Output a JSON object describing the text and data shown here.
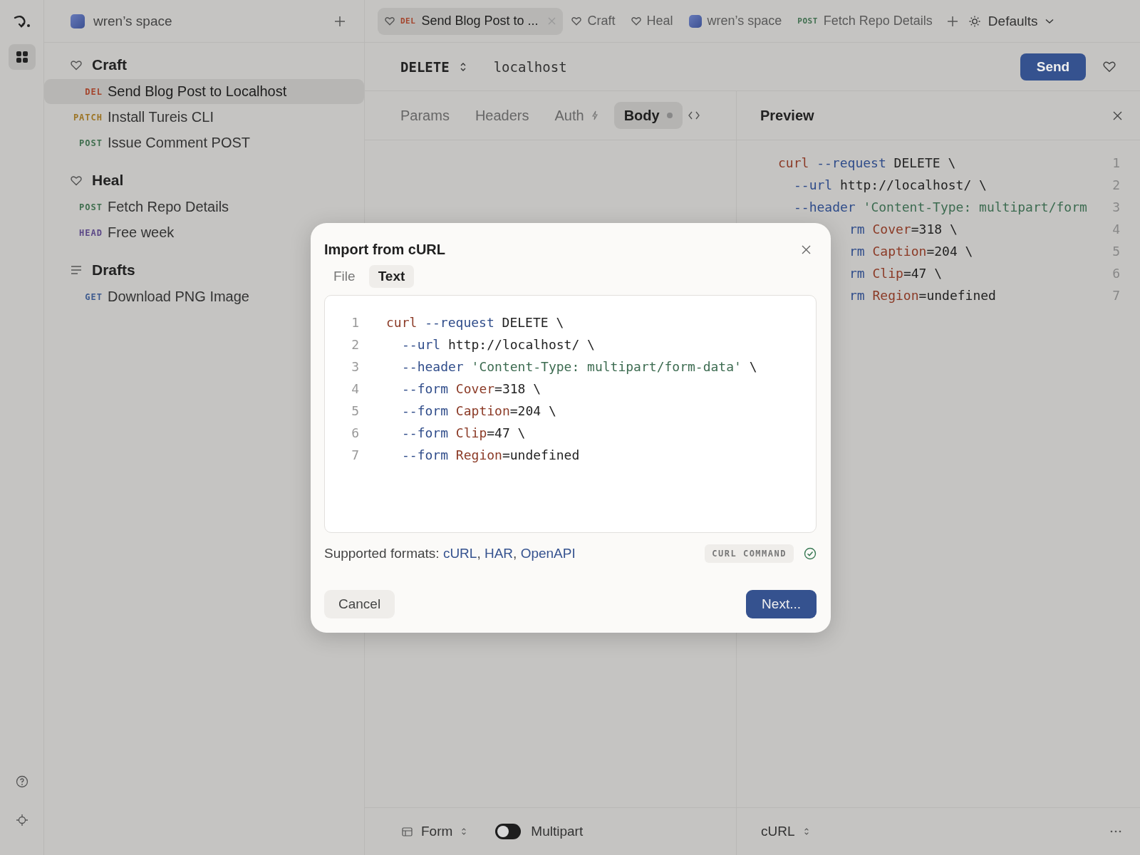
{
  "rail": {
    "items": [
      {
        "kind": "apps",
        "selected": true
      }
    ]
  },
  "sidebar": {
    "workspace": "wren’s space",
    "groups": [
      {
        "kind": "folder",
        "title": "Craft",
        "items": [
          {
            "method": "DEL",
            "label": "Send Blog Post to Localhost",
            "selected": true
          },
          {
            "method": "PATCH",
            "label": "Install Tureis CLI",
            "selected": false
          },
          {
            "method": "POST",
            "label": "Issue Comment POST",
            "selected": false
          }
        ]
      },
      {
        "kind": "folder",
        "title": "Heal",
        "items": [
          {
            "method": "POST",
            "label": "Fetch Repo Details",
            "selected": false
          },
          {
            "method": "HEAD",
            "label": "Free week",
            "selected": false
          }
        ]
      },
      {
        "kind": "drafts",
        "title": "Drafts",
        "items": [
          {
            "method": "GET",
            "label": "Download PNG Image",
            "selected": false
          }
        ]
      }
    ]
  },
  "tabs": [
    {
      "kind": "folder",
      "method": "DEL",
      "label": "Send Blog Post to ...",
      "selected": true,
      "closable": true
    },
    {
      "kind": "folder",
      "label": "Craft",
      "selected": false,
      "closable": false
    },
    {
      "kind": "folder",
      "label": "Heal",
      "selected": false,
      "closable": false
    },
    {
      "kind": "workspace",
      "label": "wren’s space",
      "selected": false,
      "closable": false
    },
    {
      "kind": "request",
      "method": "POST",
      "label": "Fetch Repo Details",
      "selected": false,
      "closable": false
    }
  ],
  "environment": "Defaults",
  "request": {
    "method": "DELETE",
    "url": "localhost",
    "send": "Send"
  },
  "body_tabs": [
    {
      "kind": "plain",
      "label": "Params",
      "selected": false
    },
    {
      "kind": "plain",
      "label": "Headers",
      "selected": false
    },
    {
      "kind": "bolt",
      "label": "Auth",
      "selected": false
    },
    {
      "kind": "dot",
      "label": "Body",
      "selected": true
    }
  ],
  "preview": {
    "title": "Preview",
    "lines": [
      {
        "number": "1",
        "kind": "first",
        "tokens": [
          {
            "kind": "cmd",
            "text": "curl"
          },
          {
            "kind": "flag",
            "text": " --request"
          },
          {
            "kind": "plain",
            "text": " DELETE \\"
          }
        ]
      },
      {
        "number": "2",
        "kind": "cont",
        "tokens": [
          {
            "kind": "flag",
            "text": "--url"
          },
          {
            "kind": "plain",
            "text": " http://localhost/ \\"
          }
        ]
      },
      {
        "number": "3",
        "kind": "cont",
        "tokens": [
          {
            "kind": "flag",
            "text": "--header"
          },
          {
            "kind": "str",
            "text": " 'Content-Type: multipart/form"
          }
        ]
      },
      {
        "number": "4",
        "kind": "cut",
        "tokens": [
          {
            "kind": "flag",
            "text": "rm"
          },
          {
            "kind": "key",
            "text": " Cover"
          },
          {
            "kind": "plain",
            "text": "=318 \\"
          }
        ]
      },
      {
        "number": "5",
        "kind": "cut",
        "tokens": [
          {
            "kind": "flag",
            "text": "rm"
          },
          {
            "kind": "key",
            "text": " Caption"
          },
          {
            "kind": "plain",
            "text": "=204 \\"
          }
        ]
      },
      {
        "number": "6",
        "kind": "cut",
        "tokens": [
          {
            "kind": "flag",
            "text": "rm"
          },
          {
            "kind": "key",
            "text": " Clip"
          },
          {
            "kind": "plain",
            "text": "=47 \\"
          }
        ]
      },
      {
        "number": "7",
        "kind": "cut",
        "tokens": [
          {
            "kind": "flag",
            "text": "rm"
          },
          {
            "kind": "key",
            "text": " Region"
          },
          {
            "kind": "plain",
            "text": "=undefined"
          }
        ]
      }
    ]
  },
  "footer": {
    "body_type": "Form",
    "multipart": {
      "label": "Multipart",
      "on": false
    },
    "preview_format": "cURL"
  },
  "dialog": {
    "title": "Import from cURL",
    "tabs": [
      {
        "label": "File",
        "selected": false
      },
      {
        "label": "Text",
        "selected": true
      }
    ],
    "lines": [
      {
        "number": "1",
        "kind": "first",
        "tokens": [
          {
            "kind": "cmd",
            "text": "curl"
          },
          {
            "kind": "flag",
            "text": " --request"
          },
          {
            "kind": "plain",
            "text": " DELETE \\"
          }
        ]
      },
      {
        "number": "2",
        "kind": "cont",
        "tokens": [
          {
            "kind": "flag",
            "text": "--url"
          },
          {
            "kind": "plain",
            "text": " http://localhost/ \\"
          }
        ]
      },
      {
        "number": "3",
        "kind": "cont",
        "tokens": [
          {
            "kind": "flag",
            "text": "--header"
          },
          {
            "kind": "str",
            "text": " 'Content-Type: multipart/form-data'"
          },
          {
            "kind": "plain",
            "text": " \\"
          }
        ]
      },
      {
        "number": "4",
        "kind": "cont",
        "tokens": [
          {
            "kind": "flag",
            "text": "--form"
          },
          {
            "kind": "key",
            "text": " Cover"
          },
          {
            "kind": "plain",
            "text": "=318 \\"
          }
        ]
      },
      {
        "number": "5",
        "kind": "cont",
        "tokens": [
          {
            "kind": "flag",
            "text": "--form"
          },
          {
            "kind": "key",
            "text": " Caption"
          },
          {
            "kind": "plain",
            "text": "=204 \\"
          }
        ]
      },
      {
        "number": "6",
        "kind": "cont",
        "tokens": [
          {
            "kind": "flag",
            "text": "--form"
          },
          {
            "kind": "key",
            "text": " Clip"
          },
          {
            "kind": "plain",
            "text": "=47 \\"
          }
        ]
      },
      {
        "number": "7",
        "kind": "cont",
        "tokens": [
          {
            "kind": "flag",
            "text": "--form"
          },
          {
            "kind": "key",
            "text": " Region"
          },
          {
            "kind": "plain",
            "text": "=undefined"
          }
        ]
      }
    ],
    "formats_label": "Supported formats:",
    "formats": [
      {
        "link": "cURL",
        "after": ","
      },
      {
        "link": "HAR",
        "after": ","
      },
      {
        "link": "OpenAPI"
      }
    ],
    "detected": "CURL COMMAND",
    "valid": true,
    "cancel": "Cancel",
    "next": "Next..."
  }
}
